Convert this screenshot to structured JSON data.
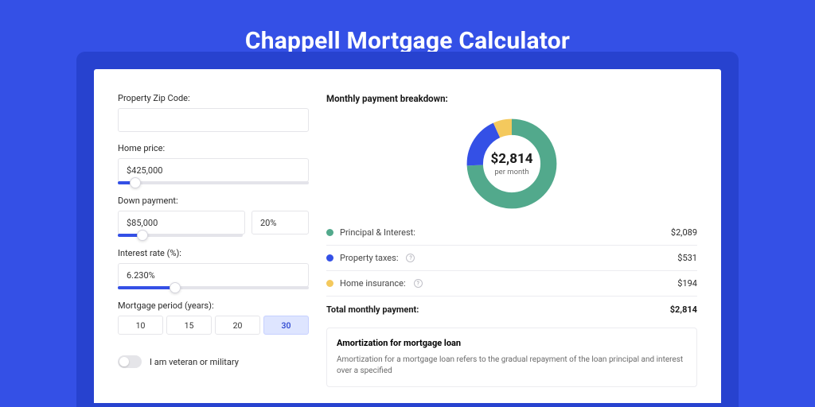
{
  "title": "Chappell Mortgage Calculator",
  "left": {
    "zip_label": "Property Zip Code:",
    "zip_value": "",
    "price_label": "Home price:",
    "price_value": "$425,000",
    "price_slider_pct": 9,
    "down_label": "Down payment:",
    "down_value": "$85,000",
    "down_pct_value": "20%",
    "down_slider_pct": 20,
    "rate_label": "Interest rate (%):",
    "rate_value": "6.230%",
    "rate_slider_pct": 30,
    "period_label": "Mortgage period (years):",
    "periods": [
      "10",
      "15",
      "20",
      "30"
    ],
    "period_active": "30",
    "veteran_label": "I am veteran or military"
  },
  "right": {
    "breakdown_title": "Monthly payment breakdown:",
    "center_value": "$2,814",
    "center_sub": "per month",
    "items": [
      {
        "label": "Principal & Interest:",
        "value": "$2,089",
        "color": "#52a98c",
        "info": false
      },
      {
        "label": "Property taxes:",
        "value": "$531",
        "color": "#3450e6",
        "info": true
      },
      {
        "label": "Home insurance:",
        "value": "$194",
        "color": "#f4c95d",
        "info": true
      }
    ],
    "total_label": "Total monthly payment:",
    "total_value": "$2,814",
    "amort_title": "Amortization for mortgage loan",
    "amort_text": "Amortization for a mortgage loan refers to the gradual repayment of the loan principal and interest over a specified"
  },
  "chart_data": {
    "type": "pie",
    "title": "Monthly payment breakdown",
    "series": [
      {
        "name": "Principal & Interest",
        "value": 2089,
        "color": "#52a98c"
      },
      {
        "name": "Property taxes",
        "value": 531,
        "color": "#3450e6"
      },
      {
        "name": "Home insurance",
        "value": 194,
        "color": "#f4c95d"
      }
    ],
    "total": 2814,
    "center_label": "$2,814 per month"
  }
}
